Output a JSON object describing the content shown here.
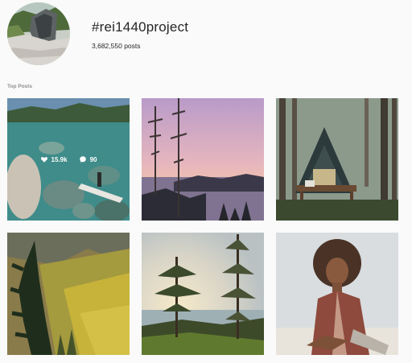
{
  "header": {
    "hashtag": "#rei1440project",
    "post_count": "3,682,550",
    "post_count_label": "posts"
  },
  "section": {
    "label": "Top Posts"
  },
  "posts": [
    {
      "likes": "15.9k",
      "comments": "90",
      "scene": "lake-rocks-paddleboard"
    },
    {
      "scene": "sunset-lake-pines"
    },
    {
      "scene": "a-frame-cabin-forest"
    },
    {
      "scene": "mountain-valley-autumn"
    },
    {
      "scene": "sunlit-pines-lake"
    },
    {
      "scene": "portrait-curly-hair"
    }
  ],
  "icons": {
    "heart": "heart-icon",
    "comment": "comment-icon"
  }
}
